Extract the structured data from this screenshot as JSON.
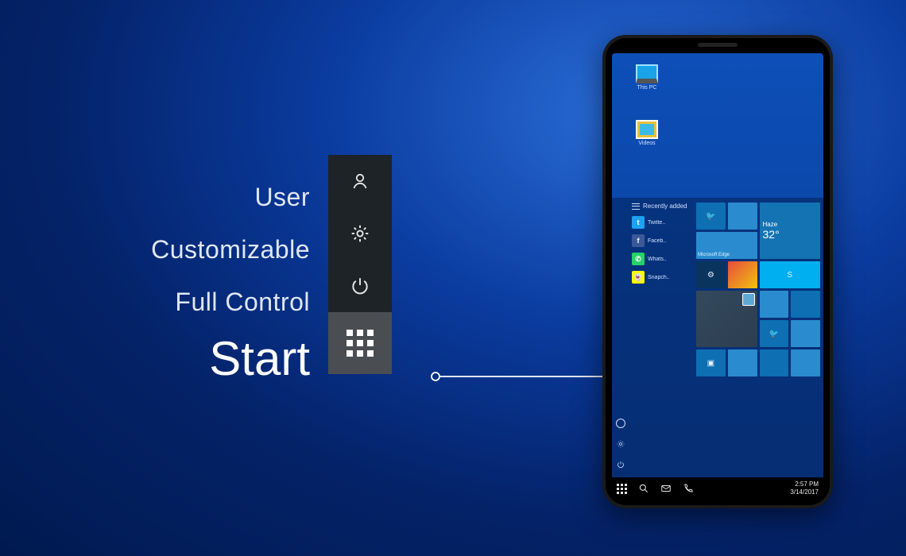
{
  "labels": {
    "user": "User",
    "customizable": "Customizable",
    "full_control": "Full Control",
    "start": "Start"
  },
  "sysmenu": {
    "user_icon": "user-icon",
    "settings_icon": "gear-icon",
    "power_icon": "power-icon",
    "start_icon": "grid-icon"
  },
  "phone": {
    "desktop_icons": {
      "this_pc": "This PC",
      "videos": "Videos"
    },
    "start_panel": {
      "header": "Recently added",
      "app_list": [
        {
          "label": "Twitte..",
          "icon": "twitter"
        },
        {
          "label": "Faceb..",
          "icon": "facebook"
        },
        {
          "label": "Whats..",
          "icon": "whatsapp"
        },
        {
          "label": "Snapch..",
          "icon": "snapchat"
        }
      ],
      "tiles": {
        "twitter": "Twitter",
        "edge": "Microsoft Edge",
        "weather_cond": "Haze",
        "weather_temp": "32°",
        "settings": "",
        "candy": "",
        "skype": "",
        "game": "",
        "twitter2": ""
      }
    },
    "taskbar": {
      "time": "2:57 PM",
      "date": "3/14/2017"
    }
  }
}
